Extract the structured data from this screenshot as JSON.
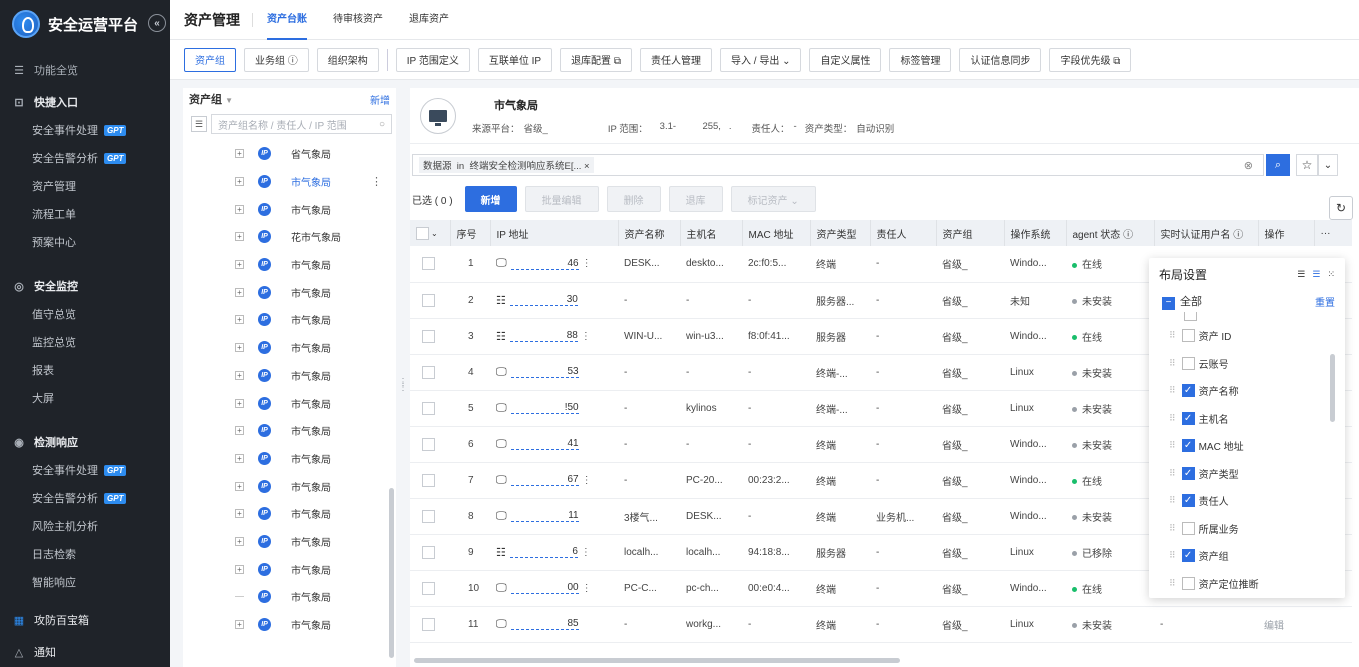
{
  "brand": {
    "name": "安全运营平台",
    "collapse": "«"
  },
  "sidebar": {
    "func_all": "功能全览",
    "quick": "快捷入口",
    "quick_items": [
      {
        "label": "安全事件处理",
        "gpt": "GPT"
      },
      {
        "label": "安全告警分析",
        "gpt": "GPT"
      },
      {
        "label": "资产管理"
      },
      {
        "label": "流程工单"
      },
      {
        "label": "预案中心"
      }
    ],
    "monitor": "安全监控",
    "monitor_items": [
      "值守总览",
      "监控总览",
      "报表",
      "大屏"
    ],
    "detect": "检测响应",
    "detect_items": [
      {
        "label": "安全事件处理",
        "gpt": "GPT"
      },
      {
        "label": "安全告警分析",
        "gpt": "GPT"
      },
      {
        "label": "风险主机分析"
      },
      {
        "label": "日志检索"
      },
      {
        "label": "智能响应"
      }
    ],
    "toolbox": "攻防百宝箱",
    "notice": "通知"
  },
  "topbar": {
    "title": "资产管理",
    "tabs": [
      "资产台账",
      "待审核资产",
      "退库资产"
    ]
  },
  "toolbar": {
    "group_tabs": [
      "资产组",
      "业务组 ⓘ",
      "组织架构"
    ],
    "buttons": [
      "IP 范围定义",
      "互联单位 IP",
      "退库配置 ⧉",
      "责任人管理",
      "导入 / 导出 ⌄",
      "自定义属性",
      "标签管理",
      "认证信息同步",
      "字段优先级 ⧉"
    ]
  },
  "tree": {
    "title": "资产组",
    "filter_icon": "▼",
    "new_label": "新增",
    "search_placeholder": "资产组名称 / 责任人 / IP 范围",
    "nodes": [
      "省气象局",
      "市气象局",
      "市气象局",
      "花市气象局",
      "市气象局",
      "市气象局",
      "市气象局",
      "市气象局",
      "市气象局",
      "市气象局",
      "市气象局",
      "市气象局",
      "市气象局",
      "市气象局",
      "市气象局",
      "市气象局",
      "市气象局",
      "市气象局"
    ]
  },
  "asset": {
    "name": "市气象局",
    "source_label": "来源平台：",
    "source_value": "省级_",
    "ip_label": "IP 范围：",
    "ip_value": "   3.1-          255,   .",
    "owner_label": "责任人：",
    "owner_value": "-",
    "type_label": "资产类型：",
    "type_value": "自动识别"
  },
  "filter": {
    "label": "数据源",
    "op": "in",
    "value": "终端安全检测响应系统E[...",
    "close": "×"
  },
  "actions": {
    "selected": "已选 ( 0 )",
    "buttons": [
      "新增",
      "批量编辑",
      "删除",
      "退库",
      "标记资产 ⌄"
    ]
  },
  "table": {
    "headers": [
      "",
      "序号",
      "IP 地址",
      "资产名称",
      "主机名",
      "MAC 地址",
      "资产类型",
      "责任人",
      "资产组",
      "操作系统",
      "agent 状态 ⓘ",
      "实时认证用户名 ⓘ",
      "操作",
      "···"
    ],
    "rows": [
      {
        "no": "1",
        "dev": "pc",
        "ip": "46",
        "kb": "⋮",
        "name": "DESK...",
        "host": "deskto...",
        "mac": "2c:f0:5...",
        "type": "终端",
        "owner": "-",
        "group": "省级_",
        "os": "Windo...",
        "status": "在线",
        "scolor": "#19be6b",
        "user": "",
        "op": ""
      },
      {
        "no": "2",
        "dev": "srv",
        "ip": "30",
        "kb": "",
        "name": "-",
        "host": "-",
        "mac": "-",
        "type": "服务器...",
        "owner": "-",
        "group": "省级_",
        "os": "未知",
        "status": "未安装",
        "scolor": "#9aa0a8",
        "user": "",
        "op": ""
      },
      {
        "no": "3",
        "dev": "srv",
        "ip": "88",
        "kb": "⋮",
        "name": "WIN-U...",
        "host": "win-u3...",
        "mac": "f8:0f:41...",
        "type": "服务器",
        "owner": "-",
        "group": "省级_",
        "os": "Windo...",
        "status": "在线",
        "scolor": "#19be6b",
        "user": "",
        "op": ""
      },
      {
        "no": "4",
        "dev": "pc",
        "ip": "53",
        "kb": "",
        "name": "-",
        "host": "-",
        "mac": "-",
        "type": "终端-...",
        "owner": "-",
        "group": "省级_",
        "os": "Linux",
        "status": "未安装",
        "scolor": "#9aa0a8",
        "user": "",
        "op": ""
      },
      {
        "no": "5",
        "dev": "pc",
        "ip": "!50",
        "kb": "",
        "name": "-",
        "host": "kylinos",
        "mac": "-",
        "type": "终端-...",
        "owner": "-",
        "group": "省级_",
        "os": "Linux",
        "status": "未安装",
        "scolor": "#9aa0a8",
        "user": "",
        "op": ""
      },
      {
        "no": "6",
        "dev": "pc",
        "ip": "41",
        "kb": "",
        "name": "-",
        "host": "-",
        "mac": "-",
        "type": "终端",
        "owner": "-",
        "group": "省级_",
        "os": "Windo...",
        "status": "未安装",
        "scolor": "#9aa0a8",
        "user": "",
        "op": ""
      },
      {
        "no": "7",
        "dev": "pc",
        "ip": "67",
        "kb": "⋮",
        "name": "-",
        "host": "PC-20...",
        "mac": "00:23:2...",
        "type": "终端",
        "owner": "-",
        "group": "省级_",
        "os": "Windo...",
        "status": "在线",
        "scolor": "#19be6b",
        "user": "",
        "op": ""
      },
      {
        "no": "8",
        "dev": "pc",
        "ip": "11",
        "kb": "",
        "name": "3楼气...",
        "host": "DESK...",
        "mac": "-",
        "type": "终端",
        "owner": "业务机...",
        "group": "省级_",
        "os": "Windo...",
        "status": "未安装",
        "scolor": "#9aa0a8",
        "user": "",
        "op": ""
      },
      {
        "no": "9",
        "dev": "srv",
        "ip": "6",
        "kb": "⋮",
        "name": "localh...",
        "host": "localh...",
        "mac": "94:18:8...",
        "type": "服务器",
        "owner": "-",
        "group": "省级_",
        "os": "Linux",
        "status": "已移除",
        "scolor": "#9aa0a8",
        "user": "",
        "op": ""
      },
      {
        "no": "10",
        "dev": "pc",
        "ip": "00",
        "kb": "⋮",
        "name": "PC-C...",
        "host": "pc-ch...",
        "mac": "00:e0:4...",
        "type": "终端",
        "owner": "-",
        "group": "省级_",
        "os": "Windo...",
        "status": "在线",
        "scolor": "#19be6b",
        "user": "",
        "op": ""
      },
      {
        "no": "11",
        "dev": "pc",
        "ip": "85",
        "kb": "",
        "name": "-",
        "host": "workg...",
        "mac": "-",
        "type": "终端",
        "owner": "-",
        "group": "省级_",
        "os": "Linux",
        "status": "未安装",
        "scolor": "#9aa0a8",
        "user": "-",
        "op": "编辑"
      }
    ]
  },
  "layout_panel": {
    "title": "布局设置",
    "all": "全部",
    "reset": "重置",
    "items": [
      {
        "label": "资产 ID",
        "on": false
      },
      {
        "label": "云账号",
        "on": false
      },
      {
        "label": "资产名称",
        "on": true
      },
      {
        "label": "主机名",
        "on": true
      },
      {
        "label": "MAC 地址",
        "on": true
      },
      {
        "label": "资产类型",
        "on": true
      },
      {
        "label": "责任人",
        "on": true
      },
      {
        "label": "所属业务",
        "on": false
      },
      {
        "label": "资产组",
        "on": true
      },
      {
        "label": "资产定位推断",
        "on": false
      }
    ]
  },
  "colors": {
    "accent": "#2d6ee0",
    "sidebar_bg": "#1f2329",
    "online": "#19be6b"
  }
}
